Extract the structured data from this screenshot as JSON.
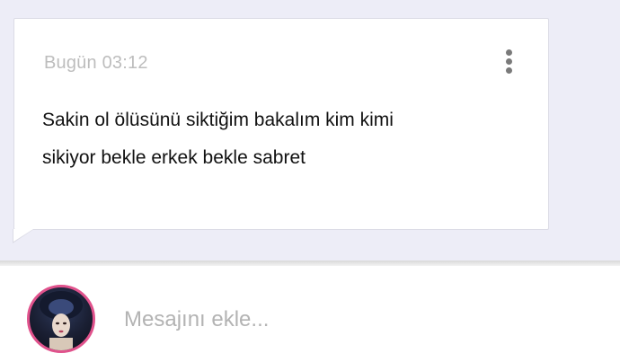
{
  "message": {
    "timestamp": "Bugün 03:12",
    "text_line1": "Sakin ol ölüsünü siktiğim bakalım kim kimi",
    "text_line2": "sikiyor bekle erkek bekle sabret",
    "more_icon": "more-vertical-icon"
  },
  "composer": {
    "placeholder": "Mesajını ekle...",
    "avatar_border_color": "#e0528c"
  },
  "colors": {
    "background": "#ededf7",
    "bubble": "#ffffff",
    "timestamp": "#bdbdbd",
    "text": "#111111"
  }
}
